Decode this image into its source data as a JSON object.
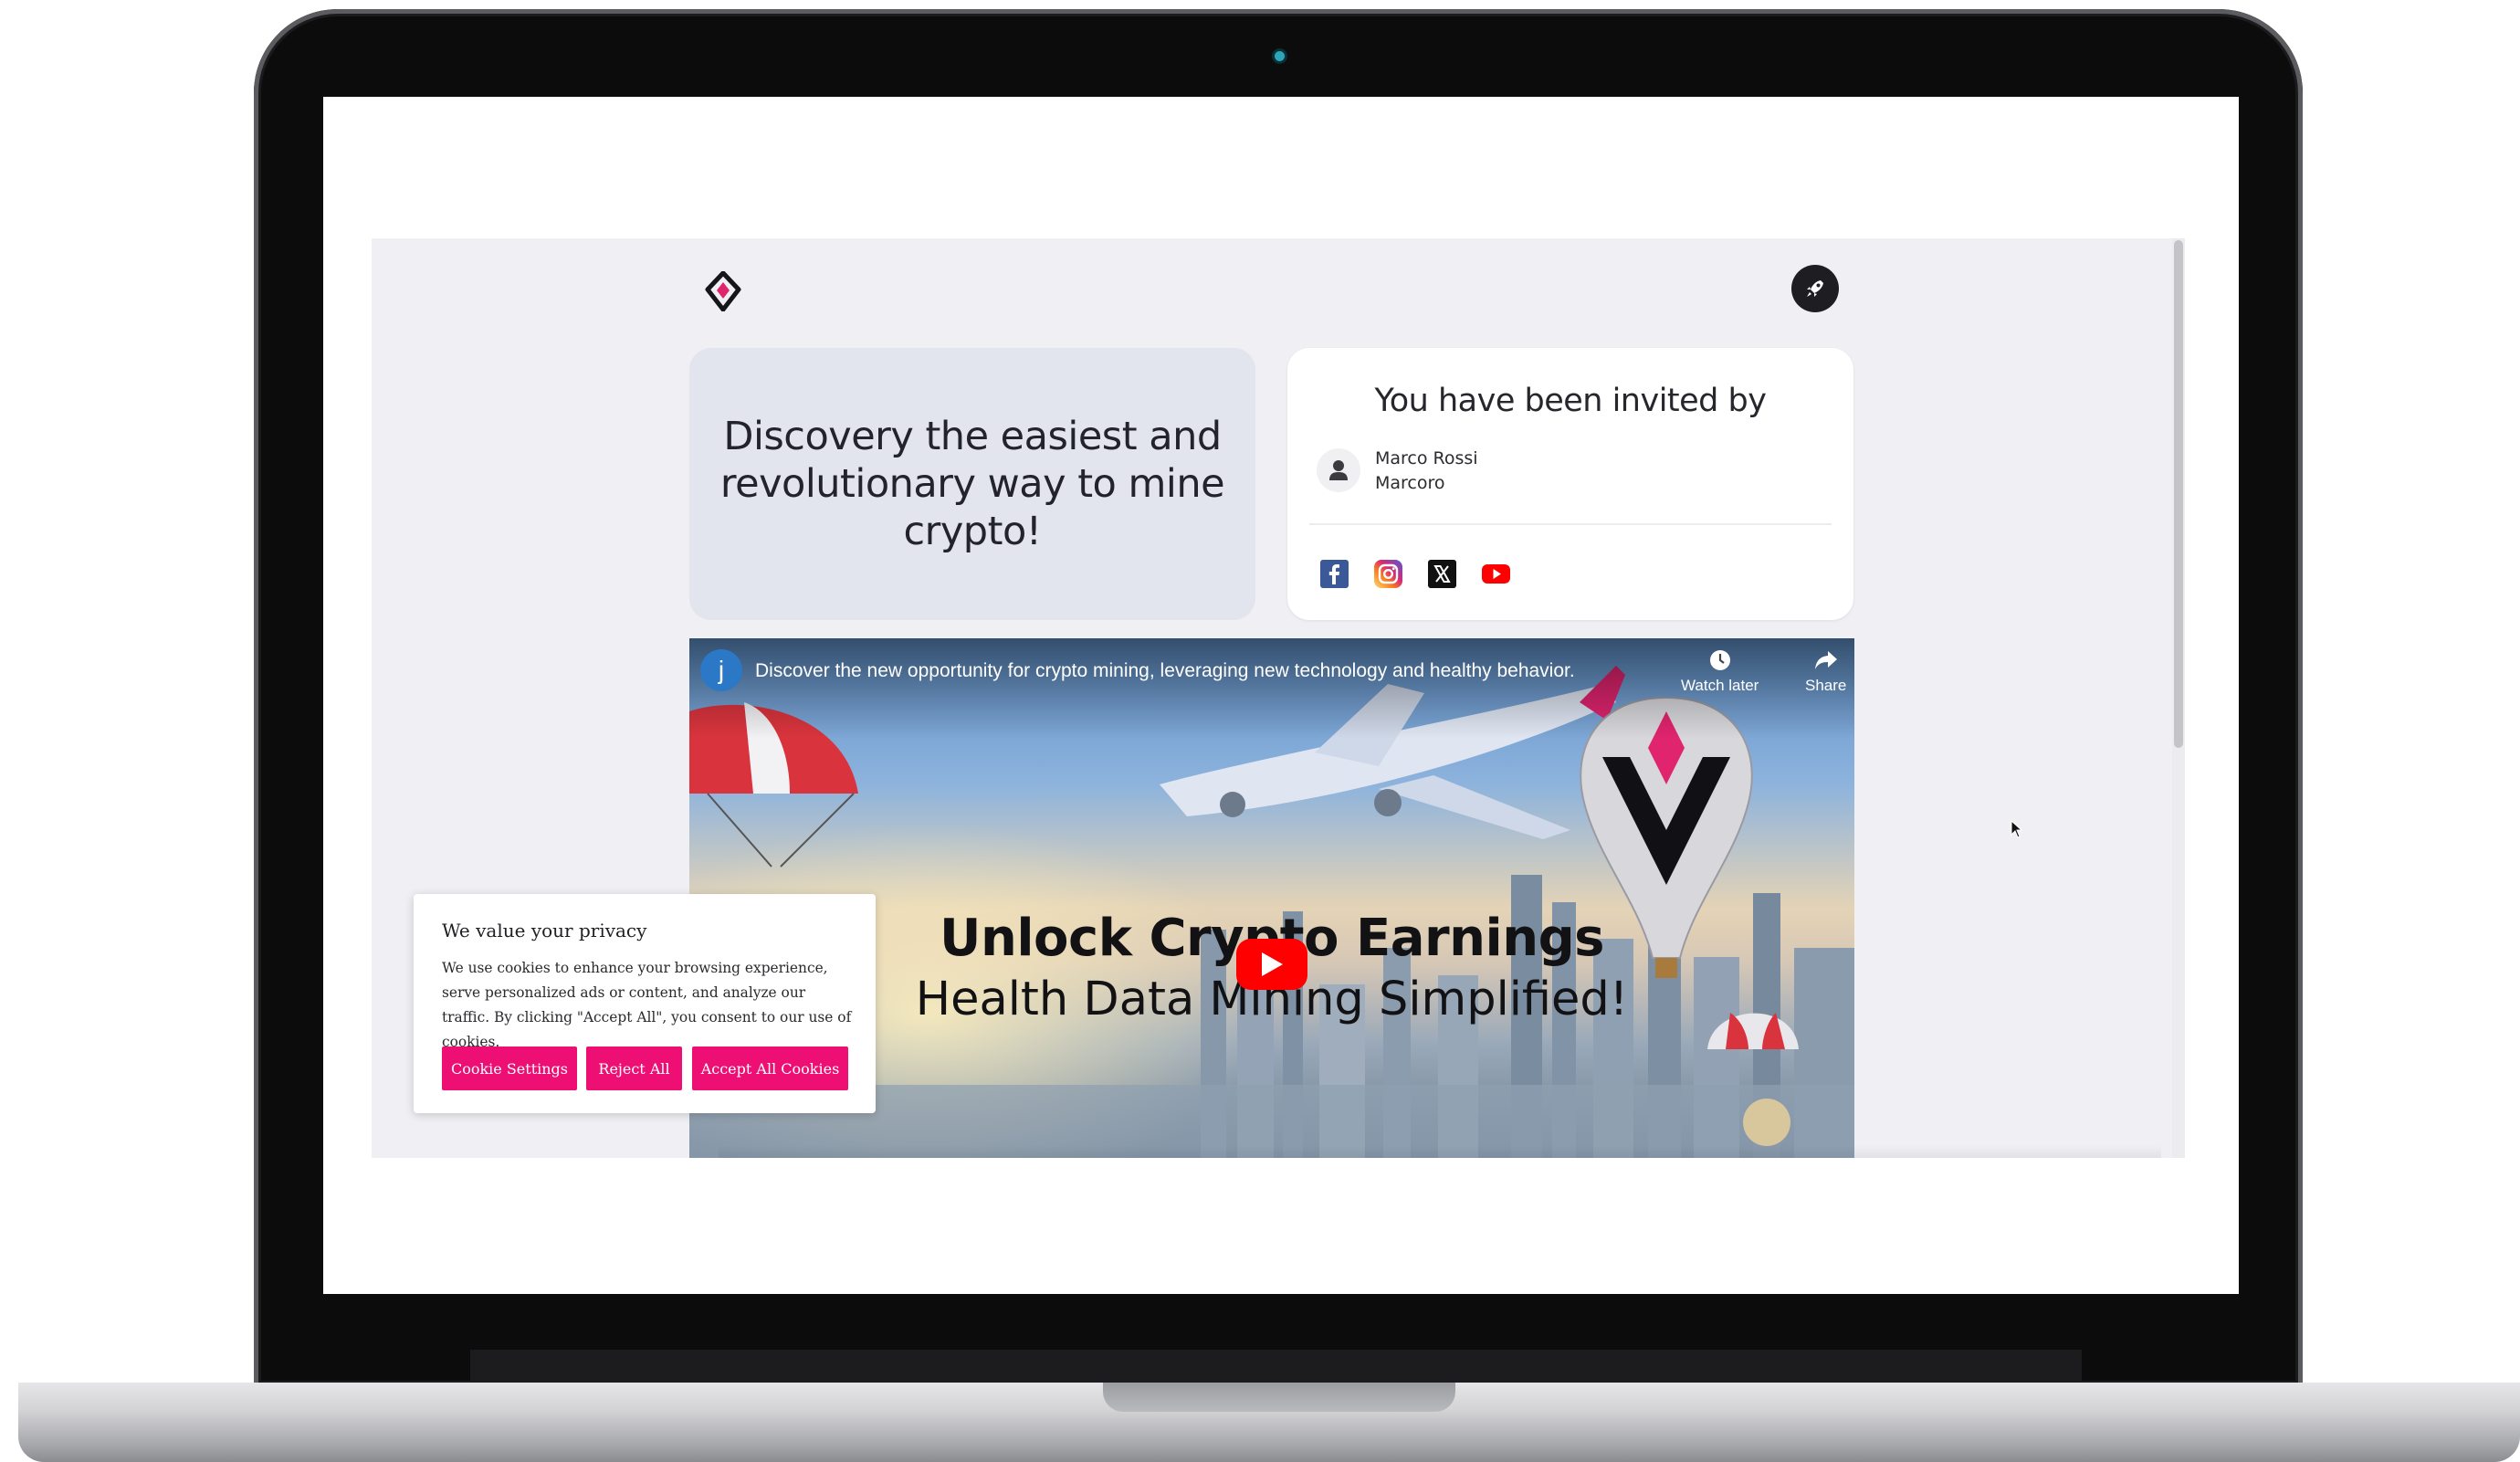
{
  "header": {
    "logo_icon": "diamond-v-logo-icon",
    "action_icon": "rocket-icon"
  },
  "hero": {
    "title": "Discovery the easiest and revolutionary way to mine crypto!"
  },
  "invite": {
    "title": "You have been invited by",
    "name": "Marco Rossi",
    "username": "Marcoro",
    "avatar_icon": "user-icon",
    "socials": [
      {
        "name": "facebook-icon",
        "color": "#3b5998"
      },
      {
        "name": "instagram-icon",
        "color": "#d62976"
      },
      {
        "name": "x-twitter-icon",
        "color": "#111111"
      },
      {
        "name": "youtube-icon",
        "color": "#ff0000"
      }
    ]
  },
  "video": {
    "channel_initial": "j",
    "title": "Discover the new opportunity for crypto mining, leveraging new technology and healthy behavior.",
    "watch_later_label": "Watch later",
    "share_label": "Share",
    "headline_1": "Unlock Crypto Earnings",
    "headline_2": "Health Data Mining Simplified!"
  },
  "cookie": {
    "title": "We value your privacy",
    "text": "We use cookies to enhance your browsing experience, serve personalized ads or content, and analyze our traffic. By clicking \"Accept All\", you consent to our use of cookies.",
    "settings_label": "Cookie Settings",
    "reject_label": "Reject All",
    "accept_label": "Accept All Cookies"
  },
  "colors": {
    "accent_pink": "#ee0f75",
    "youtube_red": "#ff0000",
    "hero_card": "#e2e4ee",
    "page_bg": "#f0f0f4"
  }
}
